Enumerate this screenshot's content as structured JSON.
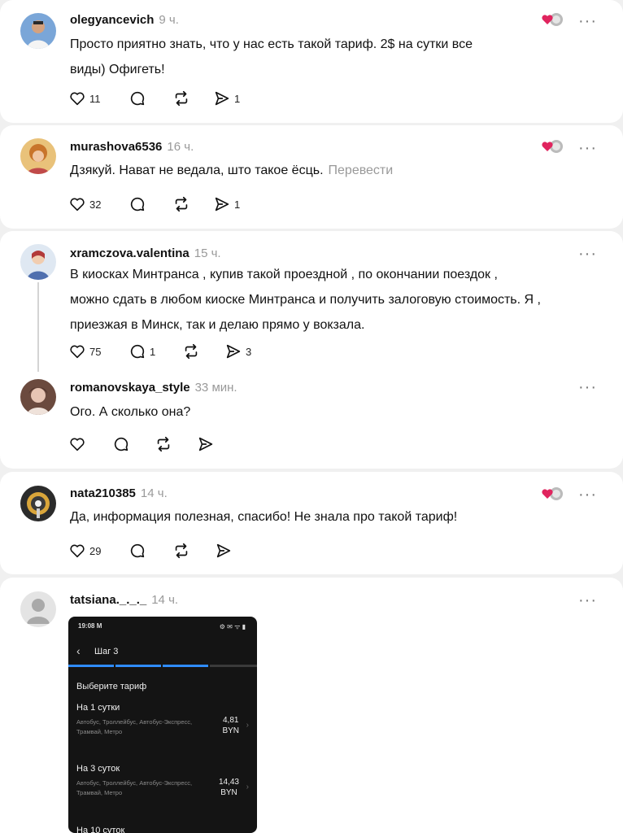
{
  "comments": [
    {
      "username": "olegyancevich",
      "time": "9 ч.",
      "text_lines": [
        "Просто приятно знать, что у нас есть такой тариф. 2$ на сутки все",
        "виды) Офигеть!"
      ],
      "likes": "11",
      "replies": "",
      "reposts": "",
      "shares": "1",
      "has_heart_badge": true
    },
    {
      "username": "murashova6536",
      "time": "16 ч.",
      "text_lines": [
        "Дзякуй. Нават не ведала, што такое ёсць."
      ],
      "translate": "Перевести",
      "likes": "32",
      "replies": "",
      "reposts": "",
      "shares": "1",
      "has_heart_badge": true
    },
    {
      "username": "xramczova.valentina",
      "time": "15 ч.",
      "text_lines": [
        "В киосках Минтранса , купив такой проездной , по окончании поездок ,",
        "можно сдать в любом киоске Минтранса и получить залоговую стоимость. Я ,",
        "приезжая в Минск, так и делаю прямо у вокзала."
      ],
      "likes": "75",
      "replies": "1",
      "reposts": "",
      "shares": "3",
      "has_heart_badge": false
    },
    {
      "username": "romanovskaya_style",
      "time": "33 мин.",
      "text_lines": [
        "Ого. А сколько она?"
      ],
      "likes": "",
      "replies": "",
      "reposts": "",
      "shares": "",
      "has_heart_badge": false
    },
    {
      "username": "nata210385",
      "time": "14 ч.",
      "text_lines": [
        "Да, информация полезная, спасибо! Не знала про такой тариф!"
      ],
      "likes": "29",
      "replies": "",
      "reposts": "",
      "shares": "",
      "has_heart_badge": true
    },
    {
      "username": "tatsiana._._._",
      "time": "14 ч.",
      "text_lines": [],
      "has_heart_badge": false
    }
  ],
  "more_icon": "···",
  "phone_screenshot": {
    "status_time": "19:08",
    "status_time_suffix": "M",
    "status_icons": "⚙ ✉ ᯤ ▮",
    "back_icon": "‹",
    "step_title": "Шаг 3",
    "choose_label": "Выберите тариф",
    "tariffs": [
      {
        "name": "На 1 сутки",
        "desc": "Автобус, Троллейбус, Автобус-Экспресс, Трамвай, Метро",
        "price": "4,81",
        "currency": "BYN"
      },
      {
        "name": "На 3 суток",
        "desc": "Автобус, Троллейбус, Автобус-Экспресс, Трамвай, Метро",
        "price": "14,43",
        "currency": "BYN"
      },
      {
        "name": "На 10 суток",
        "desc": "",
        "price": "",
        "currency": ""
      }
    ],
    "colors": {
      "progress_active": "#2f8cff",
      "progress_inactive": "#3a3a3a"
    }
  },
  "colors": {
    "heart_badge": "#e0245e",
    "separator": "#e8e8e8",
    "muted": "#999999"
  }
}
